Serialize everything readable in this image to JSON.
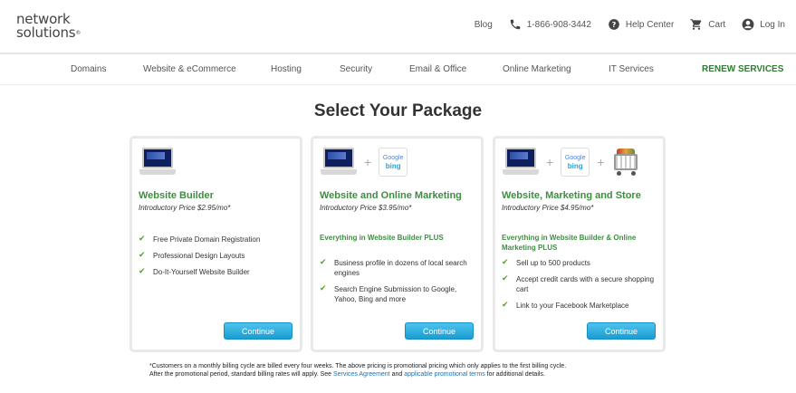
{
  "logo": {
    "line1": "network",
    "line2": "solutions",
    "mark": "®"
  },
  "util": {
    "blog": "Blog",
    "phone": "1-866-908-3442",
    "help": "Help Center",
    "cart": "Cart",
    "login": "Log In",
    "icons": [
      "phone-icon",
      "help-icon",
      "cart-icon",
      "user-icon"
    ]
  },
  "nav": [
    "Domains",
    "Website & eCommerce",
    "Hosting",
    "Security",
    "Email & Office",
    "Online Marketing",
    "IT Services",
    "RENEW SERVICES"
  ],
  "page_title": "Select Your Package",
  "packages": [
    {
      "name": "Website Builder",
      "price": "Introductory Price $2.95/mo*",
      "subtitle": "",
      "features": [
        "Free Private Domain Registration",
        "Professional Design Layouts",
        "Do-It-Yourself Website Builder"
      ],
      "button": "Continue"
    },
    {
      "name": "Website and Online Marketing",
      "price": "Introductory Price $3.95/mo*",
      "subtitle": "Everything in Website Builder PLUS",
      "features": [
        "Business profile in dozens of local search engines",
        "Search Engine Submission to Google, Yahoo, Bing and more"
      ],
      "button": "Continue"
    },
    {
      "name": "Website, Marketing and Store",
      "price": "Introductory Price $4.95/mo*",
      "subtitle": "Everything in Website Builder & Online Marketing PLUS",
      "features": [
        "Sell up to 500 products",
        "Accept credit cards with a secure shopping cart",
        "Link to your Facebook Marketplace"
      ],
      "button": "Continue"
    }
  ],
  "badges": {
    "google": "Google",
    "bing": "bing",
    "plus": "+"
  },
  "footer": {
    "line1": "*Customers on a monthly billing cycle are billed every four weeks. The above pricing is promotional pricing which only applies to the first billing cycle.",
    "line2": "After the promotional period, standard billing rates will apply. See ",
    "link1": "Services Agreement",
    "and": " and ",
    "link2": "applicable promotional terms",
    "tail": " for additional details."
  },
  "colors": {
    "green": "#3e8e41",
    "button": "#1a9dd1",
    "link": "#1a73b8"
  }
}
